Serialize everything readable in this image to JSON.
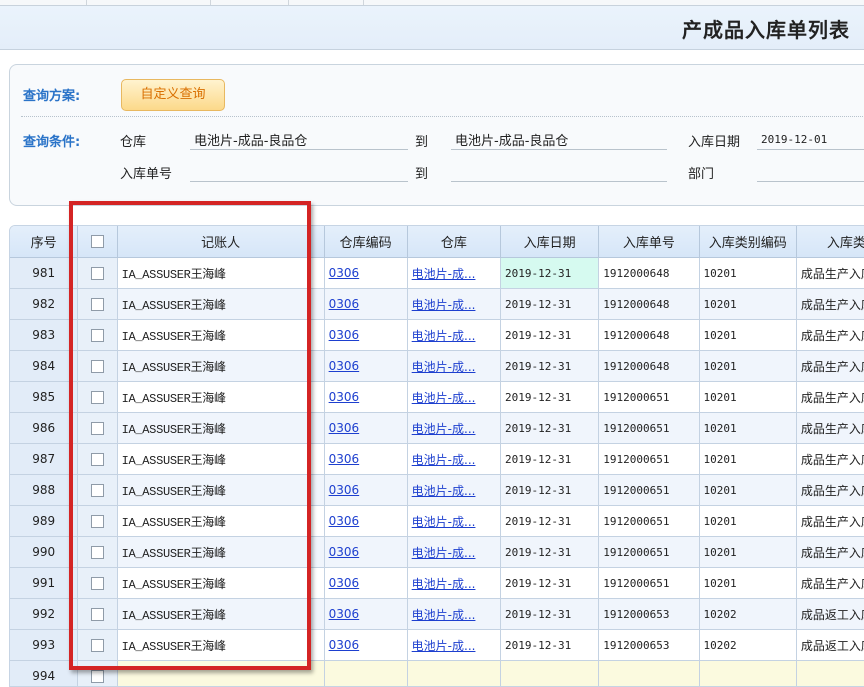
{
  "page": {
    "title": "产成品入库单列表"
  },
  "query": {
    "plan_label": "查询方案:",
    "custom_query_button": "自定义查询",
    "conditions_label": "查询条件:",
    "fields": {
      "warehouse_label": "仓库",
      "warehouse_from": "电池片-成品-良品仓",
      "warehouse_to_label": "到",
      "warehouse_to": "电池片-成品-良品仓",
      "date_label": "入库日期",
      "date_from": "2019-12-01",
      "doc_no_label": "入库单号",
      "doc_no_from": "",
      "doc_no_to_label": "到",
      "doc_no_to": "",
      "dept_label": "部门",
      "dept_value": ""
    }
  },
  "grid": {
    "columns": [
      "序号",
      "",
      "记账人",
      "仓库编码",
      "仓库",
      "入库日期",
      "入库单号",
      "入库类别编码",
      "入库类别"
    ],
    "rows": [
      {
        "seq": "981",
        "bookkeeper": "IA_ASSUSER王海峰",
        "wh_code": "0306",
        "warehouse": "电池片-成...",
        "date": "2019-12-31",
        "doc_no": "1912000648",
        "type_code": "10201",
        "type": "成品生产入库"
      },
      {
        "seq": "982",
        "bookkeeper": "IA_ASSUSER王海峰",
        "wh_code": "0306",
        "warehouse": "电池片-成...",
        "date": "2019-12-31",
        "doc_no": "1912000648",
        "type_code": "10201",
        "type": "成品生产入库"
      },
      {
        "seq": "983",
        "bookkeeper": "IA_ASSUSER王海峰",
        "wh_code": "0306",
        "warehouse": "电池片-成...",
        "date": "2019-12-31",
        "doc_no": "1912000648",
        "type_code": "10201",
        "type": "成品生产入库"
      },
      {
        "seq": "984",
        "bookkeeper": "IA_ASSUSER王海峰",
        "wh_code": "0306",
        "warehouse": "电池片-成...",
        "date": "2019-12-31",
        "doc_no": "1912000648",
        "type_code": "10201",
        "type": "成品生产入库"
      },
      {
        "seq": "985",
        "bookkeeper": "IA_ASSUSER王海峰",
        "wh_code": "0306",
        "warehouse": "电池片-成...",
        "date": "2019-12-31",
        "doc_no": "1912000651",
        "type_code": "10201",
        "type": "成品生产入库"
      },
      {
        "seq": "986",
        "bookkeeper": "IA_ASSUSER王海峰",
        "wh_code": "0306",
        "warehouse": "电池片-成...",
        "date": "2019-12-31",
        "doc_no": "1912000651",
        "type_code": "10201",
        "type": "成品生产入库"
      },
      {
        "seq": "987",
        "bookkeeper": "IA_ASSUSER王海峰",
        "wh_code": "0306",
        "warehouse": "电池片-成...",
        "date": "2019-12-31",
        "doc_no": "1912000651",
        "type_code": "10201",
        "type": "成品生产入库"
      },
      {
        "seq": "988",
        "bookkeeper": "IA_ASSUSER王海峰",
        "wh_code": "0306",
        "warehouse": "电池片-成...",
        "date": "2019-12-31",
        "doc_no": "1912000651",
        "type_code": "10201",
        "type": "成品生产入库"
      },
      {
        "seq": "989",
        "bookkeeper": "IA_ASSUSER王海峰",
        "wh_code": "0306",
        "warehouse": "电池片-成...",
        "date": "2019-12-31",
        "doc_no": "1912000651",
        "type_code": "10201",
        "type": "成品生产入库"
      },
      {
        "seq": "990",
        "bookkeeper": "IA_ASSUSER王海峰",
        "wh_code": "0306",
        "warehouse": "电池片-成...",
        "date": "2019-12-31",
        "doc_no": "1912000651",
        "type_code": "10201",
        "type": "成品生产入库"
      },
      {
        "seq": "991",
        "bookkeeper": "IA_ASSUSER王海峰",
        "wh_code": "0306",
        "warehouse": "电池片-成...",
        "date": "2019-12-31",
        "doc_no": "1912000651",
        "type_code": "10201",
        "type": "成品生产入库"
      },
      {
        "seq": "992",
        "bookkeeper": "IA_ASSUSER王海峰",
        "wh_code": "0306",
        "warehouse": "电池片-成...",
        "date": "2019-12-31",
        "doc_no": "1912000653",
        "type_code": "10202",
        "type": "成品返工入库"
      },
      {
        "seq": "993",
        "bookkeeper": "IA_ASSUSER王海峰",
        "wh_code": "0306",
        "warehouse": "电池片-成...",
        "date": "2019-12-31",
        "doc_no": "1912000653",
        "type_code": "10202",
        "type": "成品返工入库"
      }
    ],
    "partial_row_seq": "994"
  },
  "colors": {
    "label_blue": "#2a73c8",
    "link_blue": "#1d3fcf",
    "highlight_red": "#d42424",
    "selected_cell": "#d6faf0",
    "custom_button_text": "#d96f00"
  }
}
